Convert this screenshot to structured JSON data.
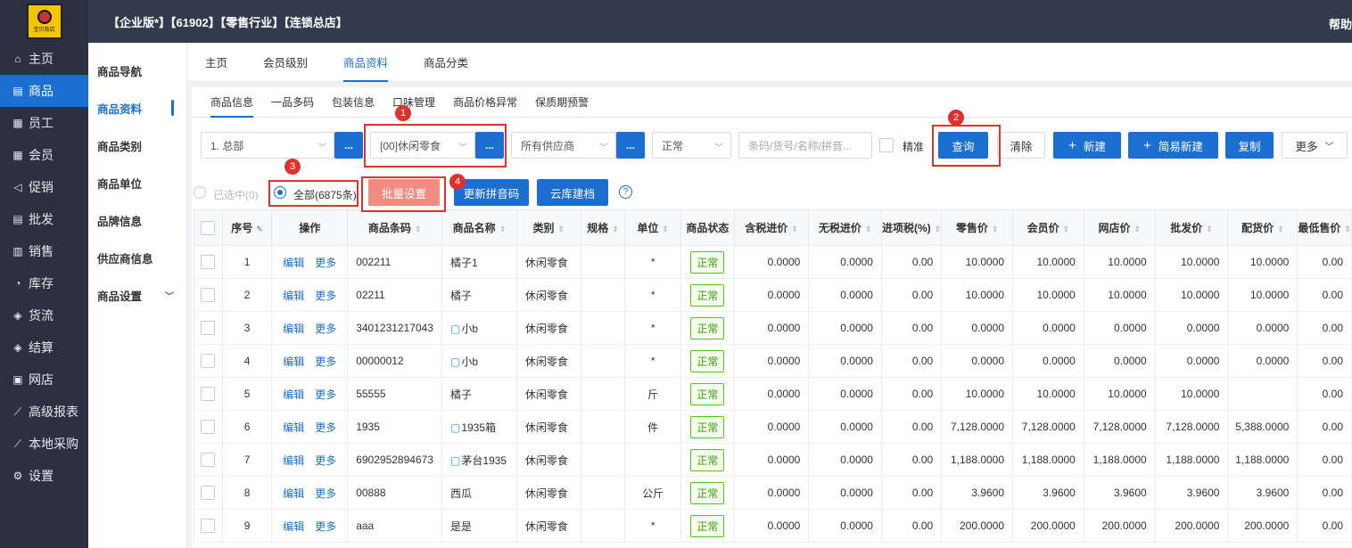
{
  "logo": {
    "text": "宝贝商店"
  },
  "topbar": {
    "title": "【企业版*】【61902】【零售行业】【连锁总店】",
    "help": "帮助"
  },
  "left_nav": [
    {
      "label": "主页",
      "icon": "home-icon",
      "glyph": "⌂"
    },
    {
      "label": "商品",
      "icon": "goods-icon",
      "glyph": "▤"
    },
    {
      "label": "员工",
      "icon": "staff-icon",
      "glyph": "▦"
    },
    {
      "label": "会员",
      "icon": "member-icon",
      "glyph": "▦"
    },
    {
      "label": "促销",
      "icon": "promo-icon",
      "glyph": "◁"
    },
    {
      "label": "批发",
      "icon": "wholesale-icon",
      "glyph": "▤"
    },
    {
      "label": "销售",
      "icon": "sales-icon",
      "glyph": "▥"
    },
    {
      "label": "库存",
      "icon": "stock-icon",
      "glyph": "◔"
    },
    {
      "label": "货流",
      "icon": "flow-icon",
      "glyph": "◈"
    },
    {
      "label": "结算",
      "icon": "settle-icon",
      "glyph": "◈"
    },
    {
      "label": "网店",
      "icon": "shop-icon",
      "glyph": "▣"
    },
    {
      "label": "高级报表",
      "icon": "report-icon",
      "glyph": "⟋"
    },
    {
      "label": "本地采购",
      "icon": "purchase-icon",
      "glyph": "⟋"
    },
    {
      "label": "设置",
      "icon": "settings-icon",
      "glyph": "⚙"
    }
  ],
  "sub_nav": [
    "商品导航",
    "商品资料",
    "商品类别",
    "商品单位",
    "品牌信息",
    "供应商信息",
    "商品设置"
  ],
  "main_tabs": [
    "主页",
    "会员级别",
    "商品资料",
    "商品分类"
  ],
  "sub_tabs": [
    "商品信息",
    "一品多码",
    "包装信息",
    "口味管理",
    "商品价格异常",
    "保质期预警"
  ],
  "filters": {
    "branch": "1. 总部",
    "category": "[00]休闲零食",
    "supplier": "所有供应商",
    "status": "正常",
    "search_placeholder": "条码/货号/名称/拼音...",
    "exact_label": "精准",
    "dots": "...",
    "query": "查询",
    "clear": "清除",
    "new": "新建",
    "quick_new": "简易新建",
    "copy": "复制",
    "more": "更多"
  },
  "actions": {
    "selected": "已选中(0)",
    "all": "全部(6875条)",
    "batch": "批量设置",
    "pinyin": "更新拼音码",
    "cloud": "云库建档",
    "help": "?"
  },
  "markers": [
    "1",
    "2",
    "3",
    "4"
  ],
  "table": {
    "headers": [
      "序号",
      "操作",
      "商品条码",
      "商品名称",
      "类别",
      "规格",
      "单位",
      "商品状态",
      "含税进价",
      "无税进价",
      "进项税(%)",
      "零售价",
      "会员价",
      "网店价",
      "批发价",
      "配货价",
      "最低售价"
    ],
    "edit": "编辑",
    "more": "更多",
    "rows": [
      {
        "no": "1",
        "code": "002211",
        "name": "橘子1",
        "cube": false,
        "cat": "休闲零食",
        "spec": "",
        "unit": "*",
        "status": "正常",
        "p1": "0.0000",
        "p2": "0.0000",
        "tax": "0.00",
        "retail": "10.0000",
        "member": "10.0000",
        "online": "10.0000",
        "whole": "10.0000",
        "dist": "10.0000",
        "min": "0.00"
      },
      {
        "no": "2",
        "code": "02211",
        "name": "橘子",
        "cube": false,
        "cat": "休闲零食",
        "spec": "",
        "unit": "*",
        "status": "正常",
        "p1": "0.0000",
        "p2": "0.0000",
        "tax": "0.00",
        "retail": "10.0000",
        "member": "10.0000",
        "online": "10.0000",
        "whole": "10.0000",
        "dist": "10.0000",
        "min": "0.00"
      },
      {
        "no": "3",
        "code": "3401231217043",
        "name": "小b",
        "cube": true,
        "cat": "休闲零食",
        "spec": "",
        "unit": "*",
        "status": "正常",
        "p1": "0.0000",
        "p2": "0.0000",
        "tax": "0.00",
        "retail": "0.0000",
        "member": "0.0000",
        "online": "0.0000",
        "whole": "0.0000",
        "dist": "0.0000",
        "min": "0.00"
      },
      {
        "no": "4",
        "code": "00000012",
        "name": "小b",
        "cube": true,
        "cat": "休闲零食",
        "spec": "",
        "unit": "*",
        "status": "正常",
        "p1": "0.0000",
        "p2": "0.0000",
        "tax": "0.00",
        "retail": "0.0000",
        "member": "0.0000",
        "online": "0.0000",
        "whole": "0.0000",
        "dist": "0.0000",
        "min": "0.00"
      },
      {
        "no": "5",
        "code": "55555",
        "name": "橘子",
        "cube": false,
        "cat": "休闲零食",
        "spec": "",
        "unit": "斤",
        "status": "正常",
        "p1": "0.0000",
        "p2": "0.0000",
        "tax": "0.00",
        "retail": "10.0000",
        "member": "10.0000",
        "online": "10.0000",
        "whole": "10.0000",
        "dist": "",
        "min": "0.00"
      },
      {
        "no": "6",
        "code": "1935",
        "name": "1935箱",
        "cube": true,
        "cat": "休闲零食",
        "spec": "",
        "unit": "件",
        "status": "正常",
        "p1": "0.0000",
        "p2": "0.0000",
        "tax": "0.00",
        "retail": "7,128.0000",
        "member": "7,128.0000",
        "online": "7,128.0000",
        "whole": "7,128.0000",
        "dist": "5,388.0000",
        "min": "0.00"
      },
      {
        "no": "7",
        "code": "6902952894673",
        "name": "茅台1935",
        "cube": true,
        "cat": "休闲零食",
        "spec": "",
        "unit": "",
        "status": "正常",
        "p1": "0.0000",
        "p2": "0.0000",
        "tax": "0.00",
        "retail": "1,188.0000",
        "member": "1,188.0000",
        "online": "1,188.0000",
        "whole": "1,188.0000",
        "dist": "1,188.0000",
        "min": "0.00"
      },
      {
        "no": "8",
        "code": "00888",
        "name": "西瓜",
        "cube": false,
        "cat": "休闲零食",
        "spec": "",
        "unit": "公斤",
        "status": "正常",
        "p1": "0.0000",
        "p2": "0.0000",
        "tax": "0.00",
        "retail": "3.9600",
        "member": "3.9600",
        "online": "3.9600",
        "whole": "3.9600",
        "dist": "3.9600",
        "min": "0.00"
      },
      {
        "no": "9",
        "code": "aaa",
        "name": "是是",
        "cube": false,
        "cat": "休闲零食",
        "spec": "",
        "unit": "*",
        "status": "正常",
        "p1": "0.0000",
        "p2": "0.0000",
        "tax": "0.00",
        "retail": "200.0000",
        "member": "200.0000",
        "online": "200.0000",
        "whole": "200.0000",
        "dist": "200.0000",
        "min": "0.00"
      }
    ]
  }
}
